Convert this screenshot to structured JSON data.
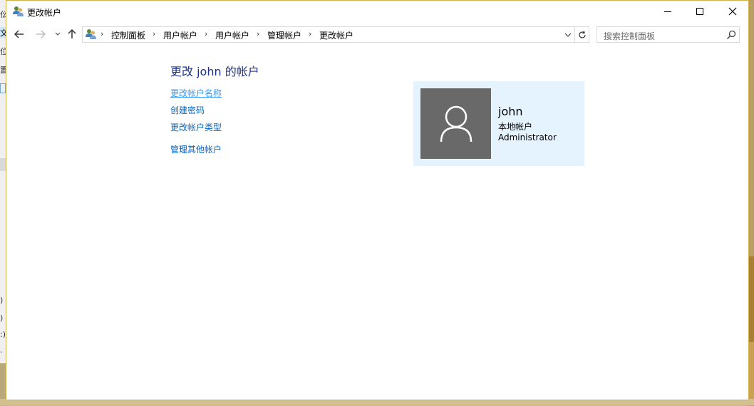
{
  "window": {
    "title": "更改帐户"
  },
  "background_window": {
    "fragments": [
      "仫",
      "文",
      "位",
      "置",
      ")",
      ")",
      ":)",
      "·"
    ]
  },
  "navigation": {
    "breadcrumbs": [
      "控制面板",
      "用户帐户",
      "用户帐户",
      "管理帐户",
      "更改帐户"
    ],
    "search_placeholder": "搜索控制面板"
  },
  "main": {
    "heading": "更改 john 的帐户",
    "tasks": {
      "rename": "更改帐户名称",
      "create_password": "创建密码",
      "change_type": "更改帐户类型",
      "manage_other": "管理其他帐户"
    }
  },
  "account": {
    "name": "john",
    "kind": "本地帐户",
    "role": "Administrator"
  },
  "colors": {
    "heading": "#1e3287",
    "link": "#0066cc",
    "card_bg": "#e5f3ff",
    "avatar_bg": "#696969"
  }
}
